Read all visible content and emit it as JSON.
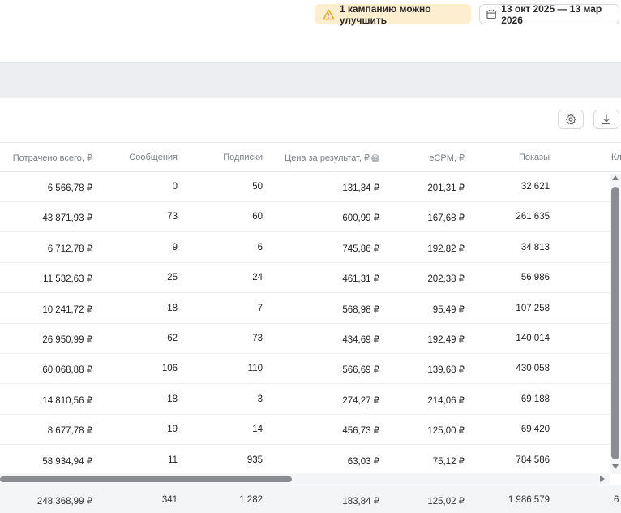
{
  "header": {
    "warning_text": "1 кампанию можно улучшить",
    "date_range": "13 окт 2025 — 13 мар 2026"
  },
  "columns": {
    "spent": "Потрачено всего, ₽",
    "messages": "Сообщения",
    "subs": "Подписки",
    "price": "Цена за результат, ₽",
    "ecpm": "eCPM, ₽",
    "shows": "Показы",
    "clicks": "Кл"
  },
  "rows": [
    {
      "spent": "6 566,78 ₽",
      "messages": "0",
      "subs": "50",
      "price": "131,34 ₽",
      "ecpm": "201,31 ₽",
      "shows": "32 621"
    },
    {
      "spent": "43 871,93 ₽",
      "messages": "73",
      "subs": "60",
      "price": "600,99 ₽",
      "ecpm": "167,68 ₽",
      "shows": "261 635"
    },
    {
      "spent": "6 712,78 ₽",
      "messages": "9",
      "subs": "6",
      "price": "745,86 ₽",
      "ecpm": "192,82 ₽",
      "shows": "34 813"
    },
    {
      "spent": "11 532,63 ₽",
      "messages": "25",
      "subs": "24",
      "price": "461,31 ₽",
      "ecpm": "202,38 ₽",
      "shows": "56 986"
    },
    {
      "spent": "10 241,72 ₽",
      "messages": "18",
      "subs": "7",
      "price": "568,98 ₽",
      "ecpm": "95,49 ₽",
      "shows": "107 258"
    },
    {
      "spent": "26 950,99 ₽",
      "messages": "62",
      "subs": "73",
      "price": "434,69 ₽",
      "ecpm": "192,49 ₽",
      "shows": "140 014"
    },
    {
      "spent": "60 068,88 ₽",
      "messages": "106",
      "subs": "110",
      "price": "566,69 ₽",
      "ecpm": "139,68 ₽",
      "shows": "430 058"
    },
    {
      "spent": "14 810,56 ₽",
      "messages": "18",
      "subs": "3",
      "price": "274,27 ₽",
      "ecpm": "214,06 ₽",
      "shows": "69 188"
    },
    {
      "spent": "8 677,78 ₽",
      "messages": "19",
      "subs": "14",
      "price": "456,73 ₽",
      "ecpm": "125,00 ₽",
      "shows": "69 420"
    },
    {
      "spent": "58 934,94 ₽",
      "messages": "11",
      "subs": "935",
      "price": "63,03 ₽",
      "ecpm": "75,12 ₽",
      "shows": "784 586"
    }
  ],
  "totals": {
    "spent": "248 368,99 ₽",
    "messages": "341",
    "subs": "1 282",
    "price": "183,84 ₽",
    "ecpm": "125,02 ₽",
    "shows": "1 986 579",
    "clicks": "6"
  },
  "icons": {
    "warning": "warning-triangle-icon",
    "calendar": "calendar-icon",
    "settings": "gear-icon",
    "download": "download-icon",
    "help": "question-icon"
  },
  "colors": {
    "warning_bg": "#fdeed0",
    "warning_icon": "#f2a81d",
    "band": "#eceef1"
  }
}
